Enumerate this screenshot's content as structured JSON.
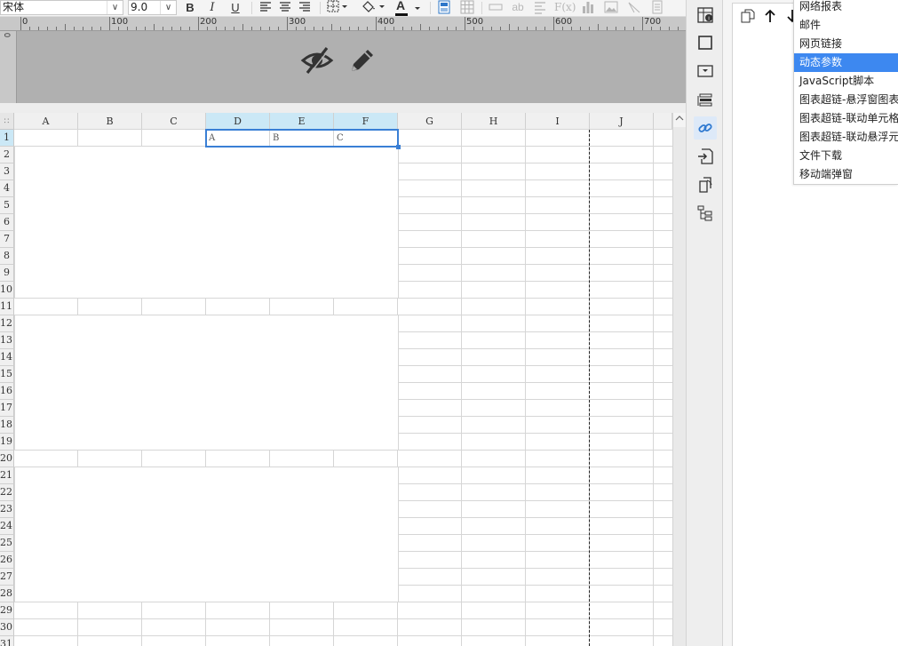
{
  "toolbar": {
    "font_name": "宋体",
    "font_size": "9.0",
    "bold": "B",
    "italic": "I",
    "underline": "U",
    "font_color_glyph": "A",
    "font_color": "#111111",
    "text_color_bar": "#d0021b"
  },
  "ruler": {
    "marks": [
      "0",
      "100",
      "200",
      "300",
      "400",
      "500",
      "600",
      "700"
    ],
    "vertical_mark": "0"
  },
  "header_band": {
    "hide_icon": "eye-slash-icon",
    "edit_icon": "pencil-icon"
  },
  "grid": {
    "columns": [
      "A",
      "B",
      "C",
      "D",
      "E",
      "F",
      "G",
      "H",
      "I",
      "J"
    ],
    "selected_columns": [
      "D",
      "E",
      "F"
    ],
    "rows": [
      "1",
      "2",
      "3",
      "4",
      "5",
      "6",
      "7",
      "8",
      "9",
      "10",
      "11",
      "12",
      "13",
      "14",
      "15",
      "16",
      "17",
      "18",
      "19",
      "20",
      "21",
      "22",
      "23",
      "24",
      "25",
      "26",
      "27",
      "28",
      "29",
      "30",
      "31"
    ],
    "cells": {
      "D1": "A",
      "E1": "B",
      "F1": "C"
    },
    "selection_color": "#3a7fd5",
    "scroll_up_glyph": "^"
  },
  "rail": {
    "icons": [
      "cell-attribute-icon",
      "border-icon",
      "dropdown-widget-icon",
      "stack-icon",
      "hyperlink-icon",
      "import-icon",
      "copy-icon",
      "tree-icon"
    ],
    "active": "hyperlink-icon"
  },
  "panel": {
    "tools": [
      "copy-icon",
      "arrow-up-icon",
      "arrow-down-icon"
    ]
  },
  "menu": {
    "items": [
      "网络报表",
      "邮件",
      "网页链接",
      "动态参数",
      "JavaScript脚本",
      "图表超链-悬浮窗图表",
      "图表超链-联动单元格",
      "图表超链-联动悬浮元素",
      "文件下载",
      "移动端弹窗"
    ],
    "selected": "动态参数",
    "selected_color": "#3d88f0"
  }
}
